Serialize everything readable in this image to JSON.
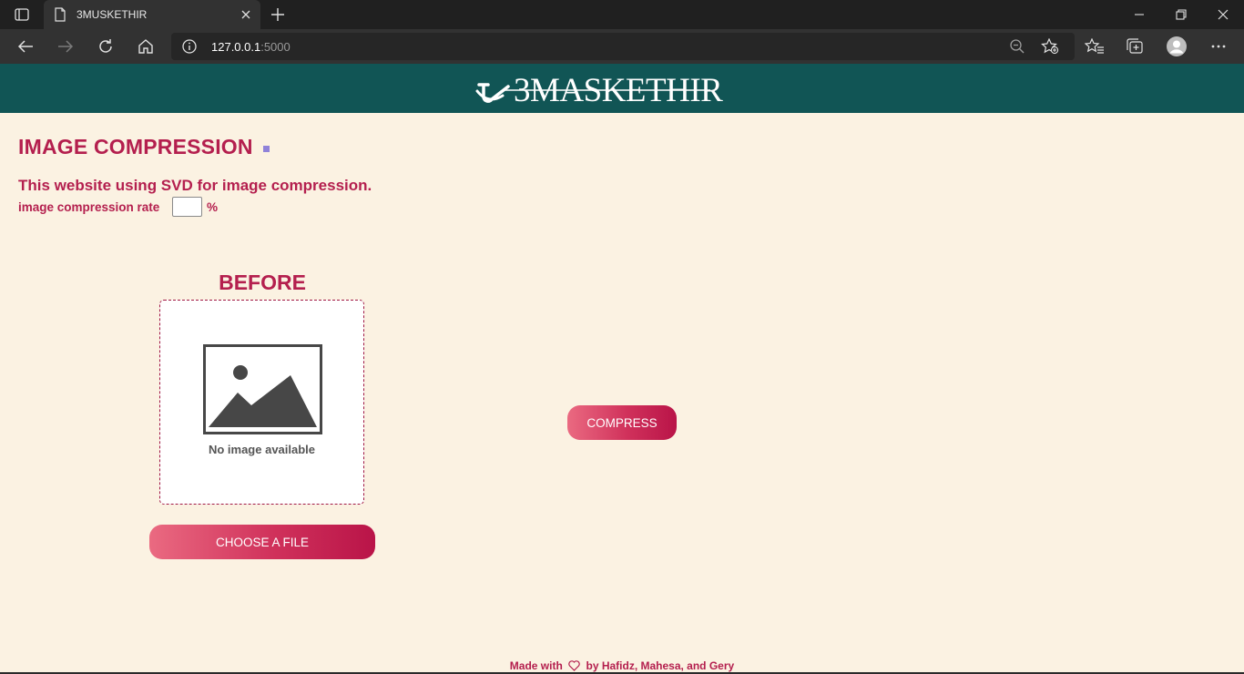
{
  "browser": {
    "tab_title": "3MUSKETHIR",
    "url_host": "127.0.0.1",
    "url_port": ":5000"
  },
  "header": {
    "logo_text": "3MASKETHIR"
  },
  "main": {
    "title": "IMAGE COMPRESSION",
    "subtitle": "This website using SVD for image compression.",
    "rate_label": "image compression rate",
    "rate_value": "",
    "rate_unit": "%",
    "before_label": "BEFORE",
    "placeholder_caption": "No image available",
    "choose_button": "CHOOSE A FILE",
    "compress_button": "COMPRESS"
  },
  "footer": {
    "prefix": "Made with",
    "suffix": "by Hafidz, Mahesa, and Gery"
  },
  "colors": {
    "header_bg": "#115555",
    "page_bg": "#fbf2e2",
    "accent": "#b41f4e",
    "title_dot": "#8f82d9"
  },
  "icons": [
    "tab-actions-icon",
    "page-icon",
    "close-icon",
    "plus-icon",
    "minimize-icon",
    "restore-icon",
    "back-icon",
    "forward-icon",
    "refresh-icon",
    "home-icon",
    "info-icon",
    "zoom-out-icon",
    "add-favorite-icon",
    "favorites-icon",
    "collections-icon",
    "profile-icon",
    "more-icon",
    "image-placeholder-icon",
    "heart-icon"
  ]
}
